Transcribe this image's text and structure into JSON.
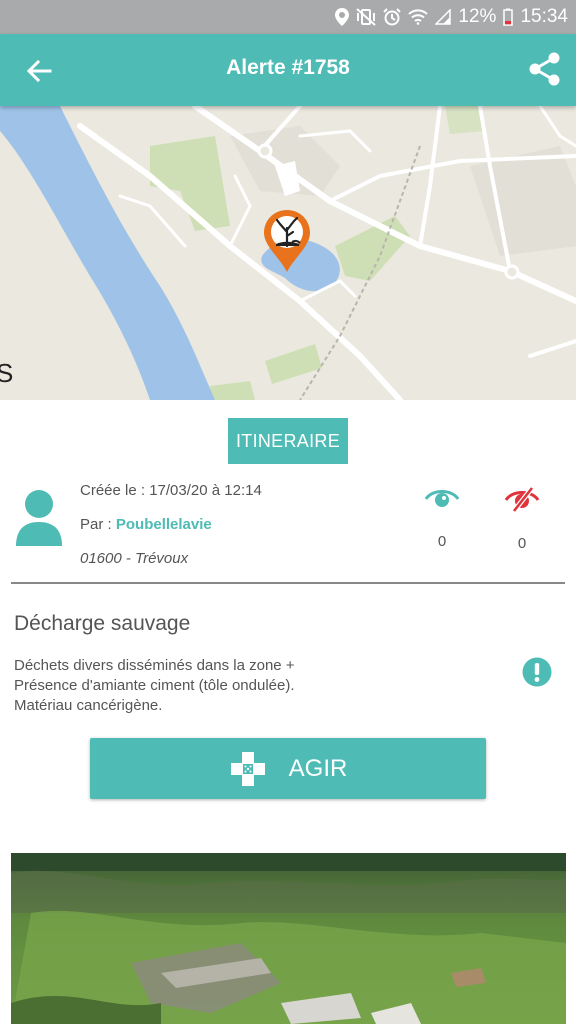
{
  "status_bar": {
    "battery_percent": "12%",
    "time": "15:34",
    "icons": [
      "location-icon",
      "vibrate-mute-icon",
      "alarm-icon",
      "wifi-icon",
      "signal-icon",
      "battery-low-icon"
    ]
  },
  "header": {
    "title": "Alerte #1758",
    "back_icon": "arrow-left-icon",
    "share_icon": "share-icon"
  },
  "map": {
    "marker_icon": "dead-tree-pollution-marker",
    "watermark": "S"
  },
  "itinerary_label": "ITINERAIRE",
  "alert_info": {
    "created_label": "Créée le : 17/03/20 à 12:14",
    "by_prefix": "Par : ",
    "author": "Poubellelavie",
    "location": "01600 - Trévoux"
  },
  "stats": {
    "views_count": "0",
    "hidden_count": "0"
  },
  "category": "Décharge sauvage",
  "description_lines": [
    "Déchets divers disséminés dans la zone +",
    "Présence d'amiante ciment (tôle ondulée).",
    "Matériau cancérigène."
  ],
  "action_button": {
    "label": "AGIR",
    "icon": "bandage-icon"
  },
  "colors": {
    "primary": "#4ebbb5",
    "status_bar": "#a9aaab",
    "marker": "#e8731c",
    "hidden_red": "#e0333a",
    "water": "#9fc3e8"
  }
}
